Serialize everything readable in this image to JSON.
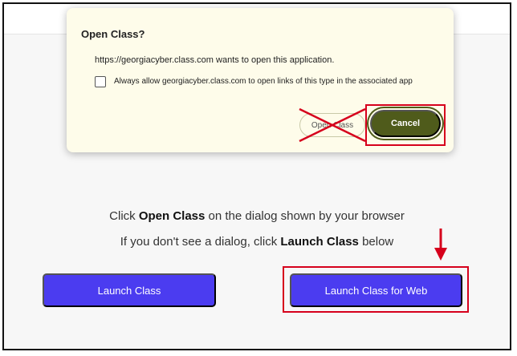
{
  "dialog": {
    "title": "Open Class?",
    "message": "https://georgiacyber.class.com wants to open this application.",
    "checkbox_label": "Always allow georgiacyber.class.com to open links of this type in the associated app",
    "open_label": "Open Class",
    "cancel_label": "Cancel"
  },
  "instructions": {
    "line1_pre": "Click ",
    "line1_bold": "Open Class",
    "line1_post": " on the dialog shown by your browser",
    "line2_pre": "If you don't see a dialog, click ",
    "line2_bold": "Launch Class",
    "line2_post": " below"
  },
  "buttons": {
    "launch_label": "Launch Class",
    "launch_web_label": "Launch Class for Web"
  },
  "colors": {
    "annotation_red": "#d6001c",
    "primary_button": "#4b3cf0",
    "cancel_button": "#4f5b1b",
    "dialog_bg": "#fefcea"
  }
}
